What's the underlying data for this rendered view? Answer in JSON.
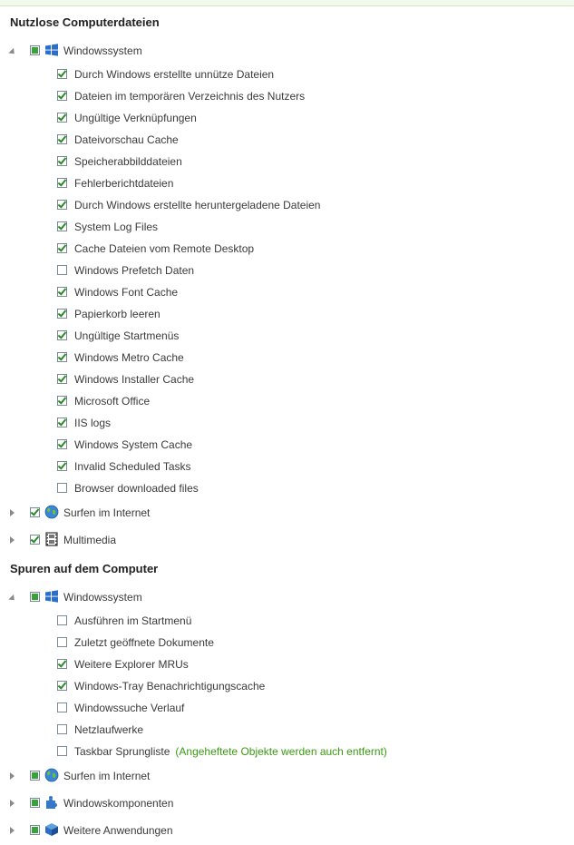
{
  "colors": {
    "accent_green": "#3b9a12",
    "checkbox_border": "#7c8a97"
  },
  "sections": [
    {
      "title": "Nutzlose Computerdateien",
      "groups": [
        {
          "label": "Windowssystem",
          "icon": "windows-logo-icon",
          "expanded": true,
          "state": "partial",
          "items": [
            {
              "label": "Durch Windows erstellte unnütze Dateien",
              "checked": true
            },
            {
              "label": "Dateien im temporären Verzeichnis des Nutzers",
              "checked": true
            },
            {
              "label": "Ungültige Verknüpfungen",
              "checked": true
            },
            {
              "label": "Dateivorschau Cache",
              "checked": true
            },
            {
              "label": "Speicherabbilddateien",
              "checked": true
            },
            {
              "label": "Fehlerberichtdateien",
              "checked": true
            },
            {
              "label": "Durch Windows erstellte heruntergeladene Dateien",
              "checked": true
            },
            {
              "label": "System Log Files",
              "checked": true
            },
            {
              "label": "Cache Dateien vom Remote Desktop",
              "checked": true
            },
            {
              "label": "Windows Prefetch Daten",
              "checked": false
            },
            {
              "label": "Windows Font Cache",
              "checked": true
            },
            {
              "label": "Papierkorb leeren",
              "checked": true
            },
            {
              "label": "Ungültige Startmenüs",
              "checked": true
            },
            {
              "label": "Windows Metro Cache",
              "checked": true
            },
            {
              "label": "Windows Installer Cache",
              "checked": true
            },
            {
              "label": "Microsoft Office",
              "checked": true
            },
            {
              "label": "IIS logs",
              "checked": true
            },
            {
              "label": "Windows System Cache",
              "checked": true
            },
            {
              "label": "Invalid Scheduled Tasks",
              "checked": true
            },
            {
              "label": "Browser downloaded files",
              "checked": false
            }
          ]
        },
        {
          "label": "Surfen im Internet",
          "icon": "globe-icon",
          "expanded": false,
          "state": "checked"
        },
        {
          "label": "Multimedia",
          "icon": "film-icon",
          "expanded": false,
          "state": "checked"
        }
      ]
    },
    {
      "title": "Spuren auf dem Computer",
      "groups": [
        {
          "label": "Windowssystem",
          "icon": "windows-logo-icon",
          "expanded": true,
          "state": "partial",
          "items": [
            {
              "label": "Ausführen im Startmenü",
              "checked": false
            },
            {
              "label": "Zuletzt geöffnete Dokumente",
              "checked": false
            },
            {
              "label": "Weitere Explorer MRUs",
              "checked": true
            },
            {
              "label": "Windows-Tray Benachrichtigungscache",
              "checked": true
            },
            {
              "label": "Windowssuche Verlauf",
              "checked": false
            },
            {
              "label": "Netzlaufwerke",
              "checked": false
            },
            {
              "label": "Taskbar Sprungliste",
              "checked": false,
              "note": "(Angeheftete Objekte werden auch entfernt)"
            }
          ]
        },
        {
          "label": "Surfen im Internet",
          "icon": "globe-icon",
          "expanded": false,
          "state": "partial"
        },
        {
          "label": "Windowskomponenten",
          "icon": "puzzle-icon",
          "expanded": false,
          "state": "partial"
        },
        {
          "label": "Weitere Anwendungen",
          "icon": "box-icon",
          "expanded": false,
          "state": "partial"
        }
      ]
    }
  ]
}
